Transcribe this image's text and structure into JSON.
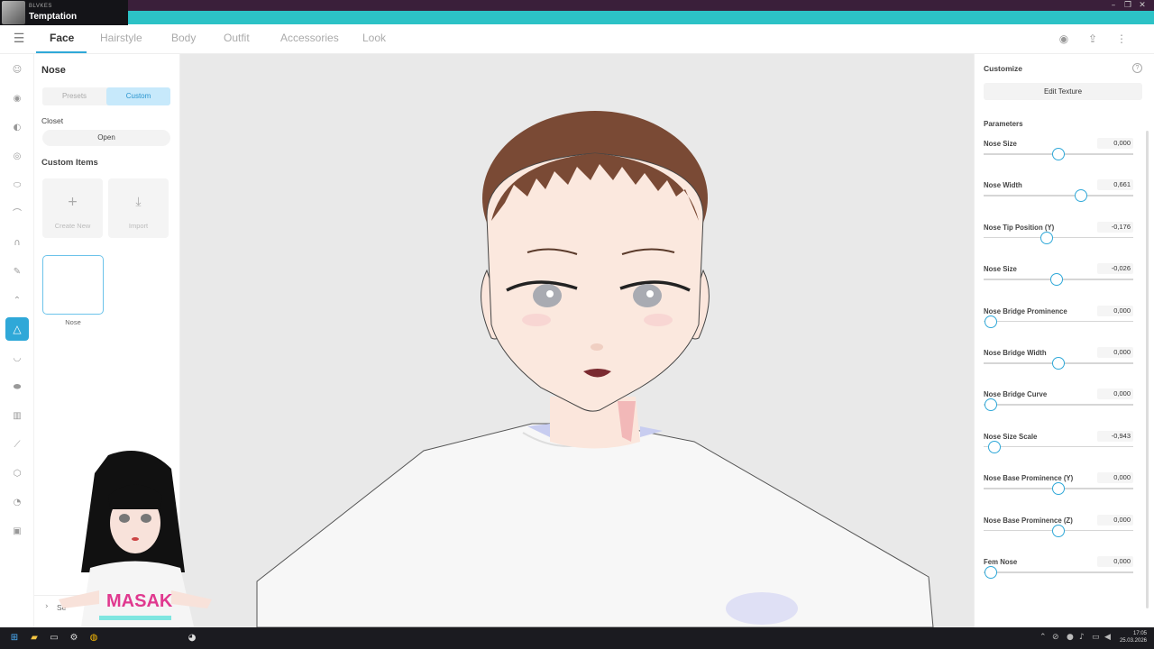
{
  "overlay": {
    "small_text": "BLVKES",
    "title": "Temptation"
  },
  "nav": {
    "tabs": [
      "Face",
      "Hairstyle",
      "Body",
      "Outfit",
      "Accessories",
      "Look"
    ],
    "active_tab": "Face"
  },
  "left_panel": {
    "title": "Nose",
    "segments": [
      "Presets",
      "Custom"
    ],
    "selected_segment": "Custom",
    "closet_label": "Closet",
    "open_label": "Open",
    "custom_items_label": "Custom Items",
    "create_new_label": "Create New",
    "import_label": "Import",
    "item_label": "Nose",
    "search_label": "Se"
  },
  "right_panel": {
    "title": "Customize",
    "edit_texture_label": "Edit Texture",
    "parameters_label": "Parameters",
    "params": [
      {
        "label": "Nose Size",
        "value": "0,000",
        "fraction": 0.5
      },
      {
        "label": "Nose Width",
        "value": "0,661",
        "fraction": 0.65
      },
      {
        "label": "Nose Tip Position (Y)",
        "value": "-0,176",
        "fraction": 0.42
      },
      {
        "label": "Nose Size",
        "value": "-0,026",
        "fraction": 0.49
      },
      {
        "label": "Nose Bridge Prominence",
        "value": "0,000",
        "fraction": 0.05
      },
      {
        "label": "Nose Bridge Width",
        "value": "0,000",
        "fraction": 0.5
      },
      {
        "label": "Nose Bridge Curve",
        "value": "0,000",
        "fraction": 0.05
      },
      {
        "label": "Nose Size Scale",
        "value": "-0,943",
        "fraction": 0.07
      },
      {
        "label": "Nose Base Prominence (Y)",
        "value": "0,000",
        "fraction": 0.5
      },
      {
        "label": "Nose Base Prominence (Z)",
        "value": "0,000",
        "fraction": 0.5
      },
      {
        "label": "Fem Nose",
        "value": "0,000",
        "fraction": 0.05
      }
    ]
  },
  "taskbar": {
    "time": "17:05",
    "date": "25.03.2026"
  },
  "colors": {
    "accent": "#2fa8d8",
    "titlebar": "#2cc2c6"
  }
}
